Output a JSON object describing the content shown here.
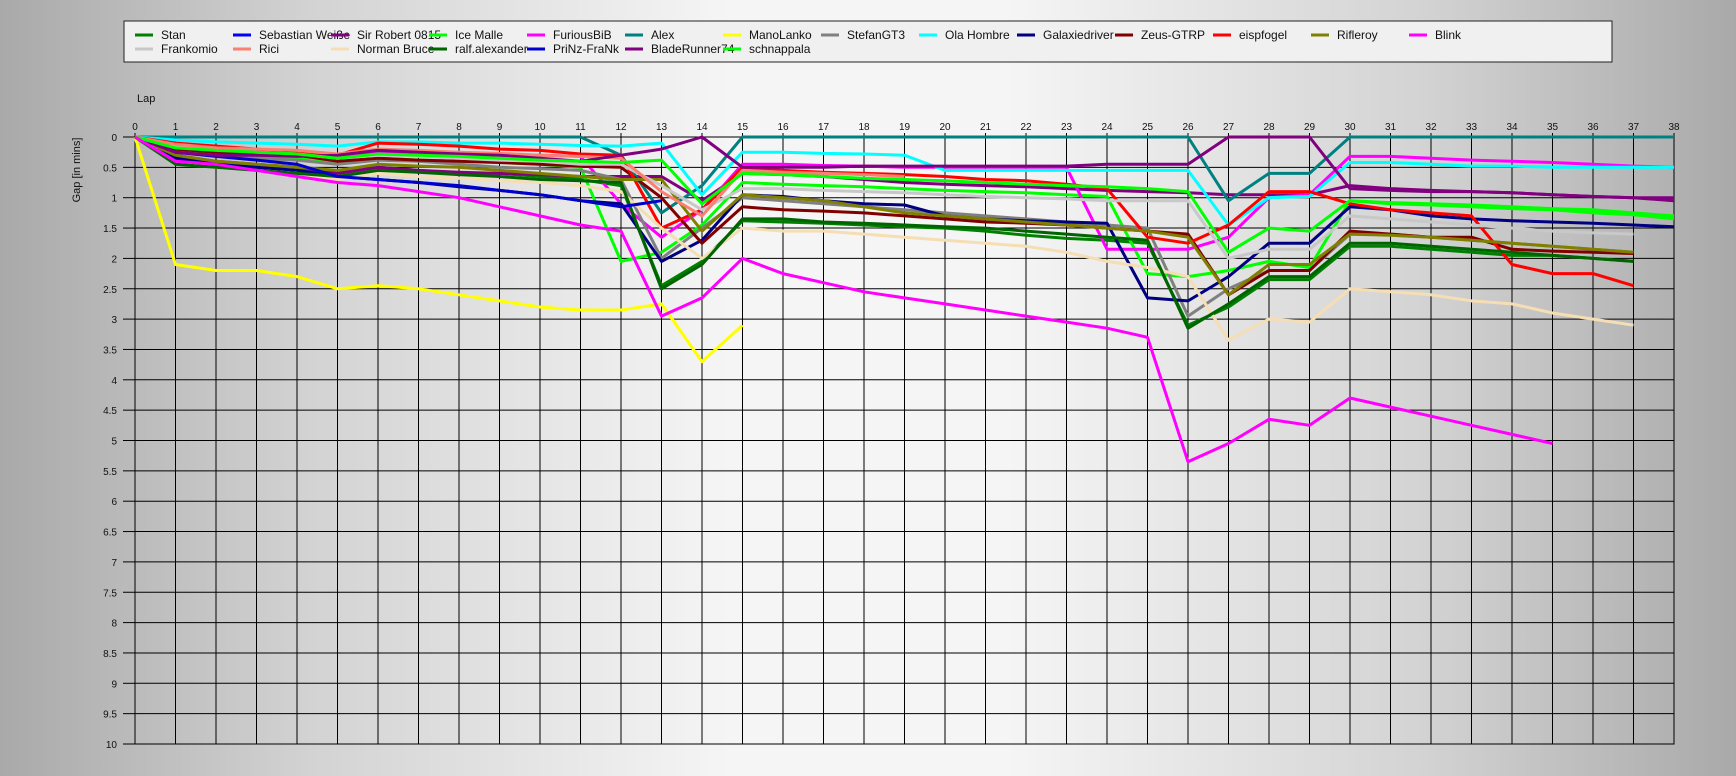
{
  "chart_data": {
    "type": "line",
    "xlabel": "Lap",
    "ylabel": "Gap [in mins]",
    "xlim": [
      0,
      38
    ],
    "ylim": [
      0,
      10
    ],
    "y_inverted": true,
    "grid": true,
    "legend_position": "top",
    "x_ticks": [
      "0",
      "1",
      "2",
      "3",
      "4",
      "5",
      "6",
      "7",
      "8",
      "9",
      "10",
      "11",
      "12",
      "13",
      "14",
      "15",
      "16",
      "17",
      "18",
      "19",
      "20",
      "21",
      "22",
      "23",
      "24",
      "25",
      "26",
      "27",
      "28",
      "29",
      "30",
      "31",
      "32",
      "33",
      "34",
      "35",
      "36",
      "37",
      "38"
    ],
    "y_ticks": [
      "0",
      "0.5",
      "1",
      "1.5",
      "2",
      "2.5",
      "3",
      "3.5",
      "4",
      "4.5",
      "5",
      "5.5",
      "6",
      "6.5",
      "7",
      "7.5",
      "8",
      "8.5",
      "9",
      "9.5",
      "10"
    ],
    "series": [
      {
        "name": "Stan",
        "color": "#008000",
        "values": [
          0,
          0.35,
          0.45,
          0.5,
          0.55,
          0.6,
          0.5,
          0.55,
          0.6,
          0.6,
          0.65,
          0.7,
          0.8,
          2.45,
          2.05,
          1.38,
          1.4,
          1.42,
          1.45,
          1.48,
          1.5,
          1.55,
          1.62,
          1.67,
          1.7,
          1.75,
          3.1,
          2.8,
          2.35,
          2.35,
          1.8,
          1.8,
          1.85,
          1.9,
          1.95,
          1.95,
          2.0,
          2.05
        ]
      },
      {
        "name": "Sebastian Weiße",
        "color": "#0000ff",
        "values": [
          0,
          0,
          0,
          0,
          0,
          0
        ]
      },
      {
        "name": "Sir Robert 0815",
        "color": "#800080",
        "values": [
          0,
          0.3,
          0.4,
          0.45,
          0.5,
          0.6,
          0.5,
          0.55,
          0.58,
          0.6,
          0.62,
          0.65,
          0.65,
          0.65,
          1.05,
          0.6,
          0.62,
          0.65,
          0.7,
          0.75,
          0.78,
          0.8,
          0.82,
          0.85,
          0.88,
          0.9,
          0.92,
          0.95,
          0.95,
          0.95,
          0.8,
          0.85,
          0.88,
          0.9,
          0.92,
          0.95,
          0.98,
          1.0,
          1.05
        ]
      },
      {
        "name": "Ice Malle",
        "color": "#00ff00",
        "values": [
          0,
          0.2,
          0.28,
          0.3,
          0.35,
          0.45,
          0.35,
          0.38,
          0.4,
          0.42,
          0.45,
          0.5,
          2.05,
          1.9,
          1.45,
          0.75,
          0.78,
          0.8,
          0.82,
          0.85,
          0.88,
          0.9,
          0.92,
          0.95,
          0.98,
          2.25,
          2.3,
          2.2,
          2.05,
          2.15,
          1.05,
          1.1,
          1.12,
          1.15,
          1.18,
          1.2,
          1.25,
          1.28,
          1.35
        ]
      },
      {
        "name": "FuriousBiB",
        "color": "#ff00ff",
        "values": [
          0,
          0.15,
          0.2,
          0.22,
          0.25,
          0.3,
          0.25,
          0.25,
          0.28,
          0.3,
          0.3,
          0.32,
          1.1,
          1.65,
          1.2,
          0.45,
          0.45,
          0.47,
          0.48,
          0.5,
          0.5,
          0.5,
          0.5,
          0.5,
          1.85,
          1.85,
          1.85,
          1.65,
          1.0,
          0.95,
          0.32,
          0.32,
          0.35,
          0.38,
          0.4,
          0.42,
          0.45,
          0.48,
          0.5
        ]
      },
      {
        "name": "Alex",
        "color": "#008080",
        "values": [
          0,
          0,
          0,
          0,
          0,
          0,
          0,
          0,
          0,
          0,
          0,
          0,
          0.3,
          1.25,
          0.8,
          0,
          0,
          0,
          0,
          0,
          0,
          0,
          0,
          0,
          0,
          0,
          0,
          1.05,
          0.6,
          0.6,
          0,
          0,
          0,
          0,
          0,
          0,
          0,
          0,
          0
        ]
      },
      {
        "name": "ManoLanko",
        "color": "#ffff00",
        "values": [
          0,
          2.1,
          2.2,
          2.2,
          2.3,
          2.5,
          2.45,
          2.5,
          2.6,
          2.7,
          2.8,
          2.85,
          2.85,
          2.75,
          3.7,
          3.1
        ]
      },
      {
        "name": "StefanGT3",
        "color": "#808080",
        "values": [
          0,
          0.25,
          0.3,
          0.35,
          0.38,
          0.45,
          0.38,
          0.4,
          0.45,
          0.5,
          0.52,
          0.55,
          0.7,
          2.0,
          1.5,
          1.0,
          1.05,
          1.1,
          1.15,
          1.2,
          1.25,
          1.3,
          1.35,
          1.4,
          1.45,
          1.5,
          2.95,
          2.5,
          2.2,
          2.2,
          1.6,
          1.6,
          1.65,
          1.7,
          1.75,
          1.8,
          1.85,
          1.9
        ]
      },
      {
        "name": "Ola Hombre",
        "color": "#00ffff",
        "values": [
          0,
          0.05,
          0.08,
          0.1,
          0.12,
          0.15,
          0.08,
          0.08,
          0.1,
          0.1,
          0.12,
          0.14,
          0.15,
          0.1,
          0.95,
          0.25,
          0.25,
          0.27,
          0.28,
          0.3,
          0.55,
          0.55,
          0.55,
          0.55,
          0.55,
          0.55,
          0.55,
          1.45,
          1.0,
          0.98,
          0.42,
          0.42,
          0.45,
          0.48,
          0.48,
          0.5,
          0.5,
          0.5,
          0.5
        ]
      },
      {
        "name": "Galaxiedriver",
        "color": "#000080",
        "values": [
          0,
          0.35,
          0.45,
          0.5,
          0.55,
          0.65,
          0.7,
          0.75,
          0.82,
          0.88,
          0.95,
          1.05,
          1.1,
          2.05,
          1.7,
          0.95,
          0.98,
          1.05,
          1.1,
          1.12,
          1.3,
          1.35,
          1.38,
          1.4,
          1.42,
          2.65,
          2.7,
          2.3,
          1.75,
          1.75,
          1.15,
          1.2,
          1.3,
          1.35,
          1.38,
          1.4,
          1.42,
          1.45,
          1.48
        ]
      },
      {
        "name": "Zeus-GTRP",
        "color": "#800000",
        "values": [
          0,
          0.2,
          0.25,
          0.28,
          0.3,
          0.4,
          0.35,
          0.38,
          0.4,
          0.42,
          0.45,
          0.48,
          0.5,
          1.0,
          1.75,
          1.15,
          1.2,
          1.22,
          1.25,
          1.3,
          1.35,
          1.4,
          1.42,
          1.45,
          1.5,
          1.55,
          1.6,
          2.6,
          2.2,
          2.2,
          1.55,
          1.6,
          1.65,
          1.65,
          1.85,
          1.88,
          1.9,
          1.92
        ]
      },
      {
        "name": "eispfogel",
        "color": "#ff0000",
        "values": [
          0,
          0.1,
          0.15,
          0.2,
          0.25,
          0.3,
          0.1,
          0.12,
          0.15,
          0.2,
          0.22,
          0.28,
          0.3,
          1.5,
          1.2,
          0.5,
          0.55,
          0.58,
          0.6,
          0.62,
          0.65,
          0.7,
          0.72,
          0.78,
          0.85,
          1.65,
          1.75,
          1.45,
          0.9,
          0.9,
          1.1,
          1.2,
          1.25,
          1.3,
          2.1,
          2.25,
          2.25,
          2.45
        ]
      },
      {
        "name": "Rifleroy",
        "color": "#808000",
        "values": [
          0,
          0.3,
          0.4,
          0.45,
          0.5,
          0.55,
          0.45,
          0.48,
          0.5,
          0.55,
          0.6,
          0.65,
          0.7,
          0.7,
          1.55,
          0.95,
          1.0,
          1.05,
          1.15,
          1.25,
          1.3,
          1.35,
          1.4,
          1.45,
          1.5,
          1.55,
          1.65,
          2.6,
          2.1,
          2.1,
          1.6,
          1.62,
          1.65,
          1.7,
          1.75,
          1.8,
          1.85,
          1.9
        ]
      },
      {
        "name": "Frankomio",
        "color": "#c8c8c8",
        "values": [
          0,
          0.15,
          0.2,
          0.25,
          0.28,
          0.35,
          0.3,
          0.32,
          0.35,
          0.38,
          0.4,
          0.45,
          0.45,
          0.8,
          1.2,
          0.85,
          0.85,
          0.88,
          0.9,
          0.92,
          0.95,
          0.98,
          1.0,
          1.02,
          1.05,
          1.05,
          1.05,
          2.0,
          1.85,
          1.85,
          1.3,
          1.35,
          1.4,
          1.45,
          1.5,
          1.55,
          1.58,
          1.6
        ]
      },
      {
        "name": "Rici",
        "color": "#fa8072",
        "values": [
          0,
          0.12,
          0.18,
          0.2,
          0.22,
          0.28,
          0.2,
          0.22,
          0.25,
          0.27,
          0.3,
          0.32,
          0.35,
          0.9,
          1.3,
          0.55,
          0.58,
          0.6,
          0.62,
          0.65
        ]
      },
      {
        "name": "Norman Bruce",
        "color": "#f5deb3",
        "values": [
          0,
          0.4,
          0.5,
          0.55,
          0.6,
          0.7,
          0.6,
          0.65,
          0.68,
          0.72,
          0.75,
          0.8,
          0.9,
          1.5,
          2.0,
          1.5,
          1.55,
          1.55,
          1.6,
          1.65,
          1.7,
          1.75,
          1.8,
          1.9,
          2.05,
          2.15,
          2.3,
          3.35,
          3.0,
          3.05,
          2.5,
          2.55,
          2.6,
          2.7,
          2.75,
          2.9,
          3.0,
          3.1
        ]
      },
      {
        "name": "ralf.alexander",
        "color": "#006400",
        "values": [
          0,
          0.45,
          0.5,
          0.55,
          0.6,
          0.65,
          0.55,
          0.58,
          0.62,
          0.65,
          0.7,
          0.72,
          0.75,
          2.5,
          2.1,
          1.35,
          1.35,
          1.4,
          1.42,
          1.45,
          1.48,
          1.5,
          1.55,
          1.6,
          1.65,
          1.7,
          3.15,
          2.75,
          2.3,
          2.3,
          1.75,
          1.75,
          1.8,
          1.85,
          1.9,
          1.95,
          2.0,
          2.05
        ]
      },
      {
        "name": "PriNz-FraNk",
        "color": "#0000cd",
        "values": [
          0,
          0.25,
          0.32,
          0.38,
          0.45,
          0.65,
          0.7,
          0.75,
          0.8,
          0.88,
          0.95,
          1.05,
          1.15,
          1.05
        ]
      },
      {
        "name": "BladeRunner74",
        "color": "#800080",
        "values": [
          0,
          0.25,
          0.3,
          0.3,
          0.32,
          0.3,
          0.22,
          0.25,
          0.28,
          0.3,
          0.35,
          0.4,
          0.3,
          0.2,
          0,
          0.5,
          0.5,
          0.5,
          0.48,
          0.48,
          0.48,
          0.48,
          0.48,
          0.48,
          0.45,
          0.45,
          0.45,
          0,
          0,
          0,
          0.85,
          0.88,
          0.9,
          0.9,
          0.92,
          0.95,
          0.98,
          1.0,
          1.0
        ]
      },
      {
        "name": "schnappala",
        "color": "#00ff00",
        "values": [
          0,
          0.18,
          0.22,
          0.25,
          0.28,
          0.35,
          0.28,
          0.3,
          0.32,
          0.35,
          0.38,
          0.4,
          0.42,
          0.38,
          1.1,
          0.6,
          0.62,
          0.65,
          0.68,
          0.7,
          0.72,
          0.75,
          0.78,
          0.8,
          0.82,
          0.85,
          0.9,
          1.9,
          1.5,
          1.55,
          1.05,
          1.08,
          1.1,
          1.12,
          1.15,
          1.18,
          1.2,
          1.25,
          1.3
        ]
      },
      {
        "name": "Blink",
        "color": "#ff00ff",
        "values": [
          0,
          0.4,
          0.45,
          0.55,
          0.65,
          0.75,
          0.8,
          0.9,
          1.0,
          1.15,
          1.3,
          1.45,
          1.55,
          2.95,
          2.65,
          2.0,
          2.25,
          2.4,
          2.55,
          2.65,
          2.75,
          2.85,
          2.95,
          3.05,
          3.15,
          3.3,
          5.35,
          5.05,
          4.65,
          4.75,
          4.3,
          4.45,
          4.6,
          4.75,
          4.9,
          5.05
        ]
      }
    ]
  }
}
